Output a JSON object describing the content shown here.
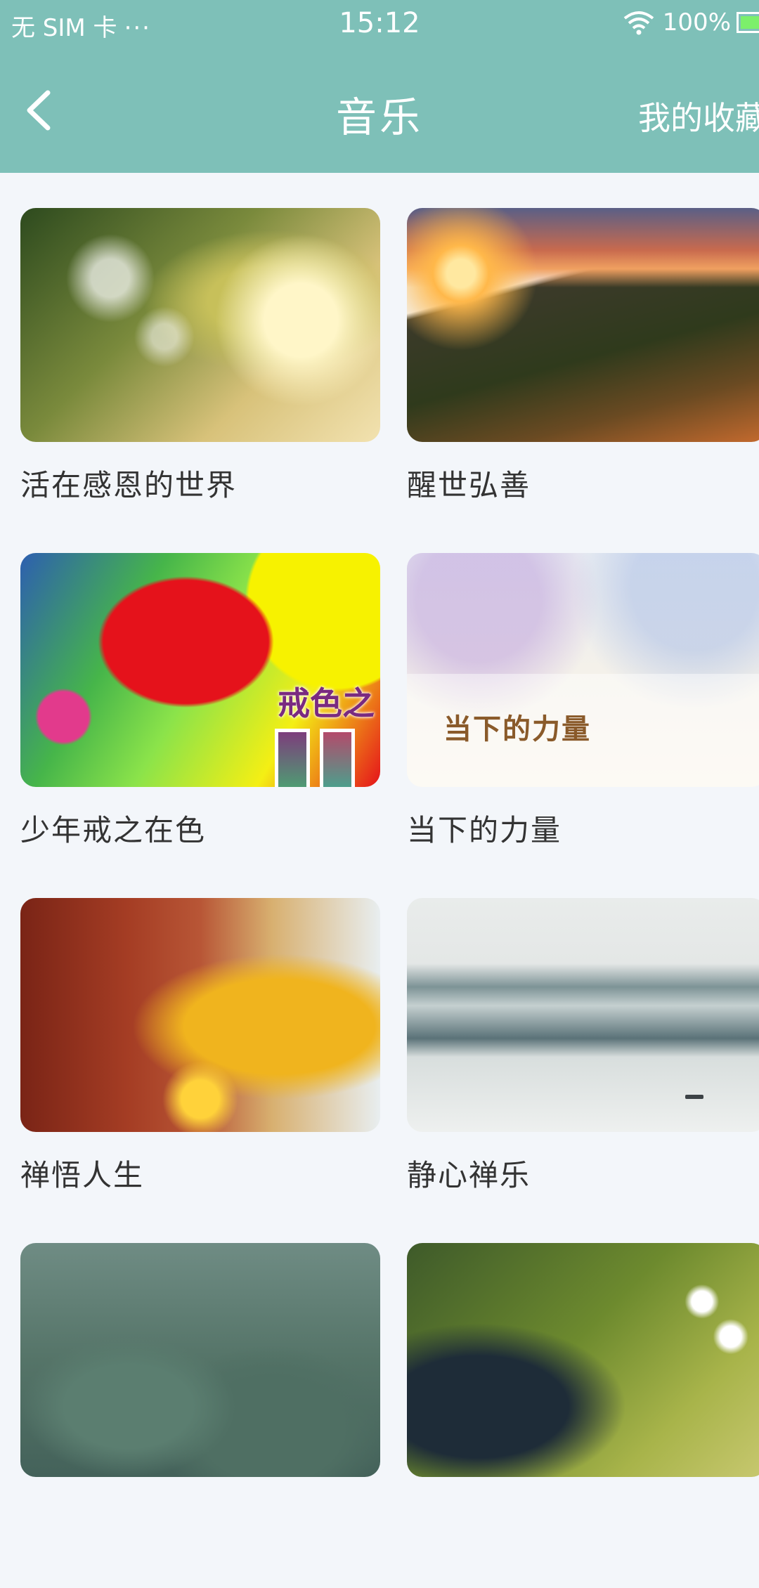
{
  "status_bar": {
    "carrier": "无 SIM 卡",
    "dots": "···",
    "time": "15:12",
    "battery": "100%"
  },
  "nav": {
    "back_icon": "chevron-left-icon",
    "title": "音乐",
    "favorites": "我的收藏"
  },
  "colors": {
    "header": "#7ec0b8",
    "background": "#f3f6fa",
    "title_text": "#333333"
  },
  "albums": [
    {
      "title": "活在感恩的世界"
    },
    {
      "title": "醒世弘善"
    },
    {
      "title": "少年戒之在色",
      "cover_text": "戒色之"
    },
    {
      "title": "当下的力量",
      "cover_text": "当下的力量"
    },
    {
      "title": "禅悟人生"
    },
    {
      "title": "静心禅乐"
    },
    {
      "title": ""
    },
    {
      "title": ""
    }
  ]
}
